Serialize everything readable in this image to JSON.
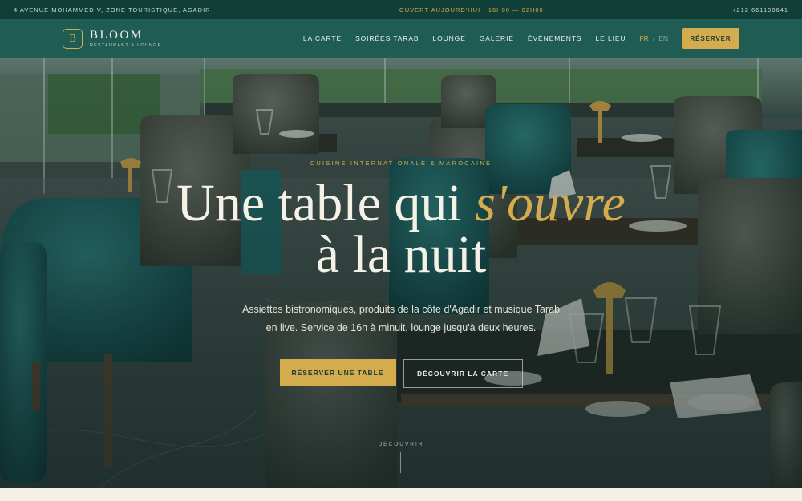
{
  "topbar": {
    "address": "4 AVENUE MOHAMMED V, ZONE TOURISTIQUE, AGADIR",
    "hours": "OUVERT AUJOURD'HUI · 16H00 — 02H00",
    "phone": "+212 661198641"
  },
  "brand": {
    "mark": "B",
    "name": "BLOOM",
    "tagline": "RESTAURANT & LOUNGE"
  },
  "nav": {
    "items": [
      "LA CARTE",
      "SOIRÉES TARAB",
      "LOUNGE",
      "GALERIE",
      "ÉVÉNEMENTS",
      "LE LIEU"
    ],
    "lang_fr": "FR",
    "lang_sep": "/",
    "lang_en": "EN",
    "cta": "RÉSERVER"
  },
  "hero": {
    "eyebrow": "CUISINE INTERNATIONALE & MAROCAINE",
    "headline_part1": "Une table qui ",
    "headline_accent": "s'ouvre",
    "headline_line2": "à la nuit",
    "lead": "Assiettes bistronomiques, produits de la côte d'Agadir et musique Tarab en live. Service de 16h à minuit, lounge jusqu'à deux heures.",
    "cta_primary": "RÉSERVER UNE TABLE",
    "cta_secondary": "DÉCOUVRIR LA CARTE",
    "scroll_label": "DÉCOUVRIR"
  },
  "colors": {
    "topbar_bg": "#103f37",
    "nav_bg": "#1f5c53",
    "accent_gold": "#d4ab4d",
    "cream": "#f4f0e6"
  }
}
